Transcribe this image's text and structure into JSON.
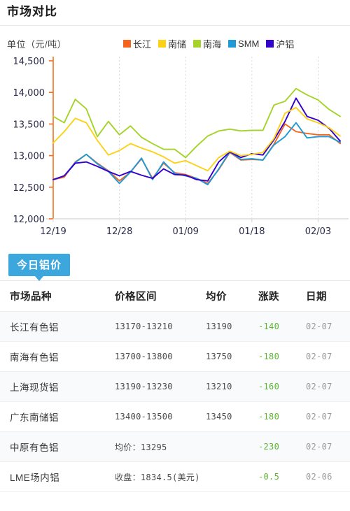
{
  "header": {
    "title": "市场对比"
  },
  "chart": {
    "unit_label": "单位（元/吨）",
    "legend": [
      {
        "label": "长江",
        "color": "#f4641e"
      },
      {
        "label": "南储",
        "color": "#fcd116"
      },
      {
        "label": "南海",
        "color": "#a5d32a"
      },
      {
        "label": "SMM",
        "color": "#1e9bd7"
      },
      {
        "label": "沪铝",
        "color": "#3300cc"
      }
    ],
    "axis_color": "#f4701f"
  },
  "chart_data": {
    "type": "line",
    "title": "市场对比",
    "xlabel": "",
    "ylabel": "单位（元/吨）",
    "ylim": [
      12000,
      14500
    ],
    "yticks": [
      12000,
      12500,
      13000,
      13500,
      14000,
      14500
    ],
    "ytick_labels": [
      "12,000",
      "12,500",
      "13,000",
      "13,500",
      "14,000",
      "14,500"
    ],
    "grid": true,
    "legend_position": "top-right",
    "xtick_labels": [
      "12/19",
      "12/28",
      "01/09",
      "01/18",
      "02/03"
    ],
    "xtick_indices": [
      0,
      6,
      12,
      18,
      24
    ],
    "x": [
      0,
      1,
      2,
      3,
      4,
      5,
      6,
      7,
      8,
      9,
      10,
      11,
      12,
      13,
      14,
      15,
      16,
      17,
      18,
      19,
      20,
      21,
      22,
      23,
      24,
      25,
      26
    ],
    "series": [
      {
        "name": "长江",
        "color": "#f4641e",
        "values": [
          12620,
          12660,
          12900,
          13020,
          12880,
          12760,
          12600,
          12740,
          12950,
          12640,
          12880,
          12730,
          12700,
          12640,
          12560,
          12780,
          13050,
          12930,
          12940,
          12930,
          13180,
          13500,
          13380,
          13350,
          13330,
          13330,
          13190
        ]
      },
      {
        "name": "南储",
        "color": "#fcd116",
        "values": [
          13200,
          13380,
          13590,
          13520,
          13240,
          13010,
          13080,
          13190,
          13120,
          13060,
          12980,
          12880,
          12920,
          12840,
          12760,
          12970,
          13070,
          13000,
          13020,
          13050,
          13270,
          13670,
          13760,
          13580,
          13520,
          13440,
          13310
        ]
      },
      {
        "name": "南海",
        "color": "#a5d32a",
        "values": [
          13620,
          13520,
          13890,
          13740,
          13300,
          13540,
          13330,
          13470,
          13290,
          13190,
          13100,
          13100,
          12970,
          13150,
          13310,
          13390,
          13420,
          13390,
          13400,
          13400,
          13800,
          13860,
          14060,
          13960,
          13880,
          13730,
          13620
        ]
      },
      {
        "name": "SMM",
        "color": "#1e9bd7",
        "values": [
          12620,
          12680,
          12890,
          13020,
          12870,
          12750,
          12560,
          12740,
          12960,
          12620,
          12900,
          12720,
          12680,
          12640,
          12540,
          12790,
          13060,
          12940,
          12950,
          12930,
          13170,
          13300,
          13520,
          13280,
          13300,
          13300,
          13210
        ]
      },
      {
        "name": "沪铝",
        "color": "#3300cc",
        "values": [
          12620,
          12680,
          12880,
          12900,
          12830,
          12750,
          12680,
          12750,
          12690,
          12640,
          12790,
          12700,
          12690,
          12620,
          12600,
          12900,
          13060,
          12970,
          13030,
          13010,
          13250,
          13540,
          13910,
          13620,
          13560,
          13430,
          13230
        ]
      }
    ]
  },
  "panel": {
    "tab_label": "今日铝价",
    "columns": [
      "市场品种",
      "价格区间",
      "均价",
      "涨跌",
      "日期"
    ],
    "rows": [
      {
        "name": "长江有色铝",
        "range": "13170-13210",
        "avg": "13190",
        "change": "-140",
        "date": "02-07"
      },
      {
        "name": "南海有色铝",
        "range": "13700-13800",
        "avg": "13750",
        "change": "-180",
        "date": "02-07"
      },
      {
        "name": "上海现货铝",
        "range": "13190-13230",
        "avg": "13210",
        "change": "-160",
        "date": "02-07"
      },
      {
        "name": "广东南储铝",
        "range": "13400-13500",
        "avg": "13450",
        "change": "-180",
        "date": "02-07"
      },
      {
        "name": "中原有色铝",
        "range": "均价：13295",
        "avg": "",
        "change": "-230",
        "date": "02-07"
      },
      {
        "name": "LME场内铝",
        "range": "收盘：1834.5(美元)",
        "avg": "",
        "change": "-0.5",
        "date": "02-06"
      }
    ],
    "change_color": "#5cb531"
  }
}
